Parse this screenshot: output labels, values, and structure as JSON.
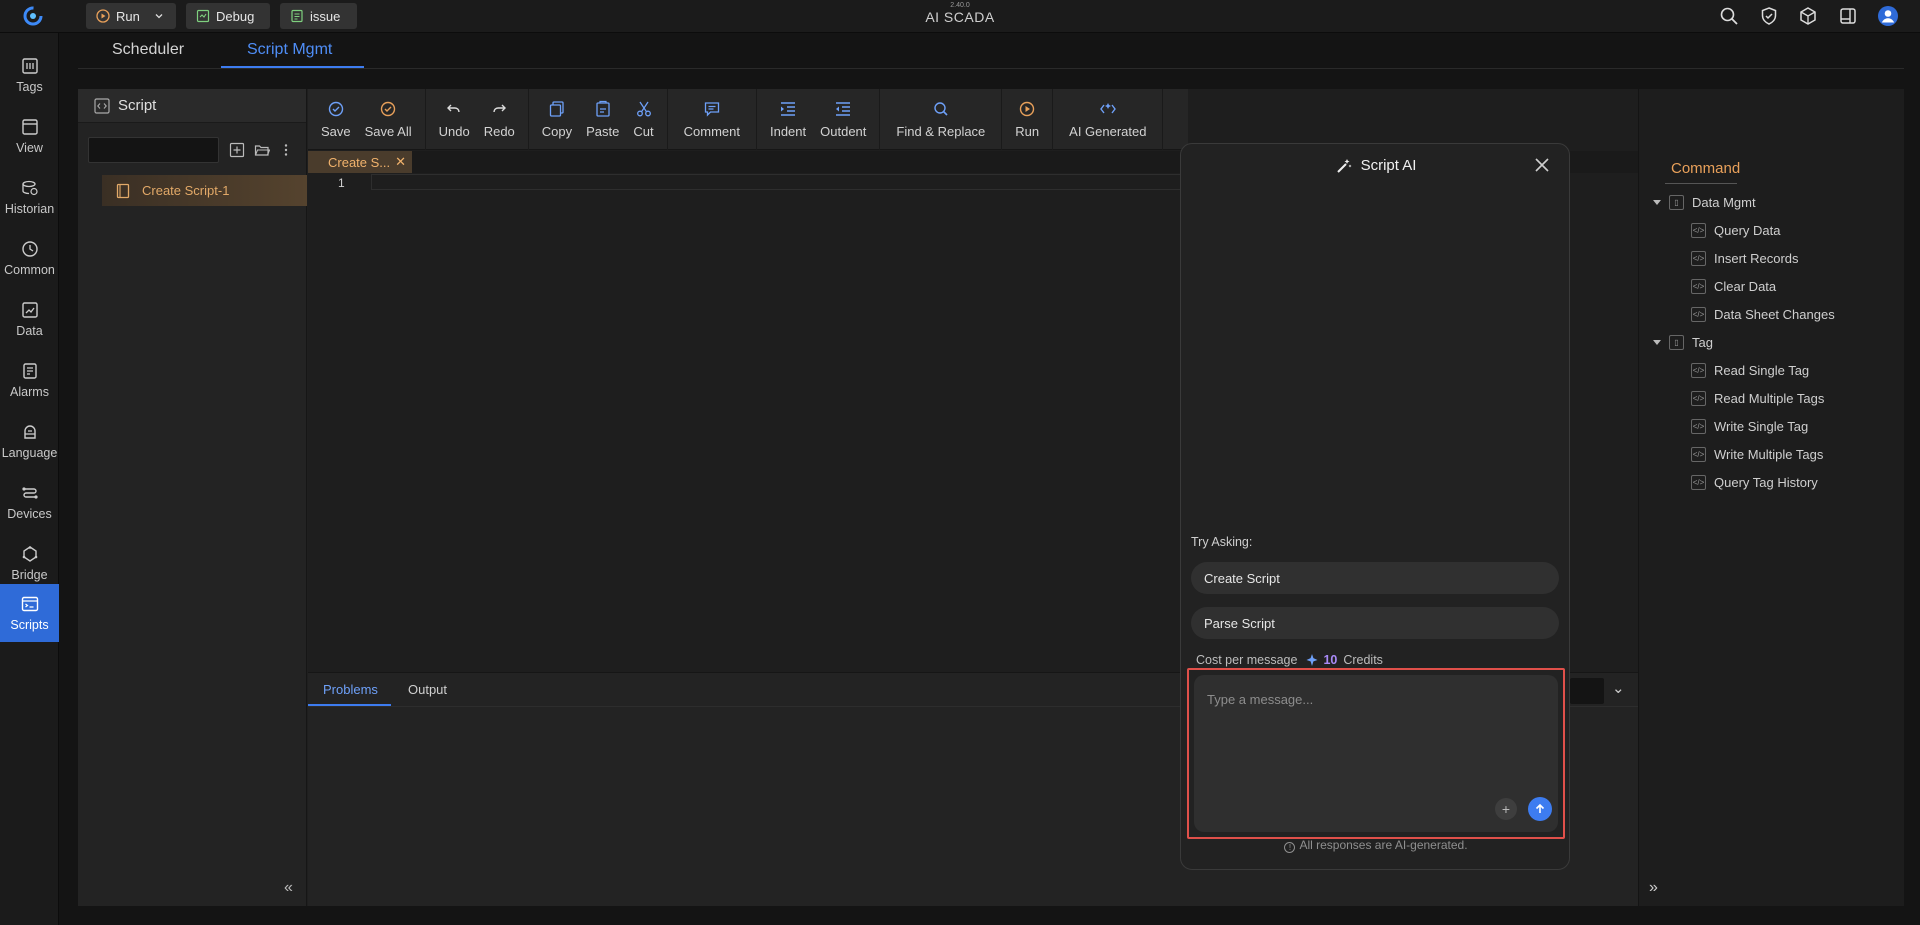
{
  "topbar": {
    "version": "2.40.0",
    "app_title": "AI SCADA",
    "run_label": "Run",
    "debug_label": "Debug",
    "issue_label": "issue"
  },
  "sidebar": {
    "items": [
      {
        "label": "Tags",
        "icon": "tags-icon"
      },
      {
        "label": "View",
        "icon": "view-icon"
      },
      {
        "label": "Historian",
        "icon": "historian-icon"
      },
      {
        "label": "Common",
        "icon": "common-icon"
      },
      {
        "label": "Data",
        "icon": "data-icon"
      },
      {
        "label": "Alarms",
        "icon": "alarms-icon"
      },
      {
        "label": "Language",
        "icon": "language-icon"
      },
      {
        "label": "Devices",
        "icon": "devices-icon"
      },
      {
        "label": "Bridge",
        "icon": "bridge-icon"
      },
      {
        "label": "Scripts",
        "icon": "scripts-icon"
      }
    ]
  },
  "main_tabs": {
    "scheduler": "Scheduler",
    "script_mgmt": "Script Mgmt"
  },
  "script_panel": {
    "title": "Script",
    "search_value": "",
    "item": "Create Script-1"
  },
  "toolbar": {
    "save": "Save",
    "save_all": "Save All",
    "undo": "Undo",
    "redo": "Redo",
    "copy": "Copy",
    "paste": "Paste",
    "cut": "Cut",
    "comment": "Comment",
    "indent": "Indent",
    "outdent": "Outdent",
    "find_replace": "Find & Replace",
    "run": "Run",
    "ai_generated": "AI Generated"
  },
  "editor": {
    "tab_label": "Create S...",
    "line_number": "1"
  },
  "bottom": {
    "problems": "Problems",
    "output": "Output"
  },
  "command": {
    "title": "Command",
    "groups": [
      {
        "name": "Data Mgmt",
        "items": [
          "Query Data",
          "Insert Records",
          "Clear Data",
          "Data Sheet Changes"
        ]
      },
      {
        "name": "Tag",
        "items": [
          "Read Single Tag",
          "Read Multiple Tags",
          "Write Single Tag",
          "Write Multiple Tags",
          "Query Tag History"
        ]
      }
    ]
  },
  "ai": {
    "title": "Script AI",
    "try_asking": "Try Asking:",
    "suggestions": [
      "Create Script",
      "Parse Script"
    ],
    "cost_label": "Cost per message",
    "cost_value": "10",
    "cost_unit": "Credits",
    "placeholder": "Type a message...",
    "footer": "All responses are AI-generated."
  },
  "colors": {
    "accent": "#3d7cf0",
    "active_item": "#e2a968",
    "highlight_border": "#e0504a",
    "credits": "#a98af7"
  }
}
